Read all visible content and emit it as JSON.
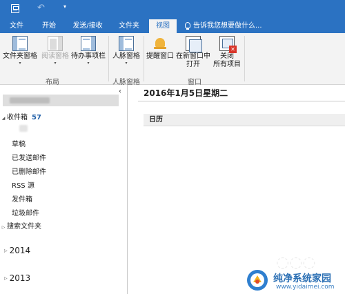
{
  "titlebar": {
    "icons": [
      "outlook-app-icon",
      "undo-icon",
      "customize-qat-icon"
    ]
  },
  "tabs": [
    {
      "label": "文件",
      "active": false
    },
    {
      "label": "开始",
      "active": false
    },
    {
      "label": "发送/接收",
      "active": false
    },
    {
      "label": "文件夹",
      "active": false
    },
    {
      "label": "视图",
      "active": true
    }
  ],
  "tellme": {
    "text": "告诉我您想要做什么..."
  },
  "ribbon": {
    "groups": [
      {
        "label": "布局",
        "buttons": [
          {
            "label": "文件夹窗格",
            "enabled": true,
            "dropdown": true
          },
          {
            "label": "阅读窗格",
            "enabled": false,
            "dropdown": true
          },
          {
            "label": "待办事项栏",
            "enabled": true,
            "dropdown": true
          }
        ]
      },
      {
        "label": "人脉窗格",
        "buttons": [
          {
            "label": "人脉窗格",
            "enabled": true,
            "dropdown": true
          }
        ]
      },
      {
        "label": "窗口",
        "buttons": [
          {
            "label": "提醒窗口",
            "enabled": true,
            "dropdown": false
          },
          {
            "label_lines": [
              "在新窗口中",
              "打开"
            ],
            "enabled": true,
            "dropdown": false
          },
          {
            "label_lines": [
              "关闭",
              "所有项目"
            ],
            "enabled": true,
            "dropdown": false
          }
        ]
      }
    ]
  },
  "nav": {
    "collapse_glyph": "‹",
    "inbox": {
      "label": "收件箱",
      "count": "57"
    },
    "folders": [
      "草稿",
      "已发送邮件",
      "已删除邮件",
      "RSS 源",
      "发件箱",
      "垃圾邮件"
    ],
    "search_folders": "搜索文件夹",
    "years": [
      "2014",
      "2013"
    ]
  },
  "main": {
    "date": "2016年1月5日星期二",
    "calendar_header": "日历"
  },
  "watermark": {
    "text": "纯净系统家园",
    "url": "www.yidaimei.com"
  },
  "colors": {
    "accent": "#2b72c2",
    "ribbon_bg": "#f3f3f3",
    "count": "#1f5fa8"
  }
}
